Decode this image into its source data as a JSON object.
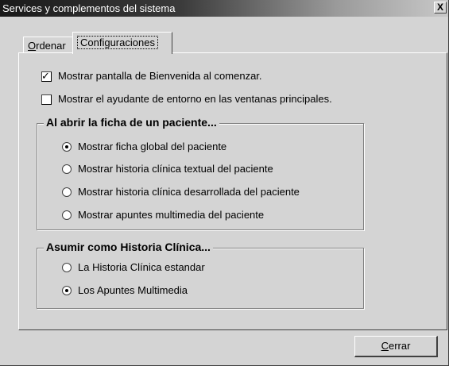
{
  "window": {
    "title": "Services y complementos del sistema",
    "close_glyph": "X"
  },
  "tabs": [
    {
      "label_mnemonic": "O",
      "label_rest": "rdenar",
      "selected": false
    },
    {
      "label": "Configuraciones",
      "selected": true
    }
  ],
  "options": {
    "welcome_screen": {
      "label": "Mostrar pantalla de Bienvenida al comenzar.",
      "checked": true
    },
    "environment_helper": {
      "label": "Mostrar el ayudante de entorno en las ventanas principales.",
      "checked": false
    }
  },
  "open_patient_group": {
    "title": "Al abrir la ficha de un paciente...",
    "options": [
      {
        "label": "Mostrar ficha global del paciente",
        "selected": true
      },
      {
        "label": "Mostrar historia clínica textual del paciente",
        "selected": false
      },
      {
        "label": "Mostrar historia clínica desarrollada del paciente",
        "selected": false
      },
      {
        "label": "Mostrar apuntes multimedia del paciente",
        "selected": false
      }
    ]
  },
  "history_group": {
    "title": "Asumir como Historia Clínica...",
    "options": [
      {
        "label": "La Historia Clínica estandar",
        "selected": false
      },
      {
        "label": "Los Apuntes Multimedia",
        "selected": true
      }
    ]
  },
  "footer": {
    "close_mnemonic": "C",
    "close_rest": "errar"
  }
}
